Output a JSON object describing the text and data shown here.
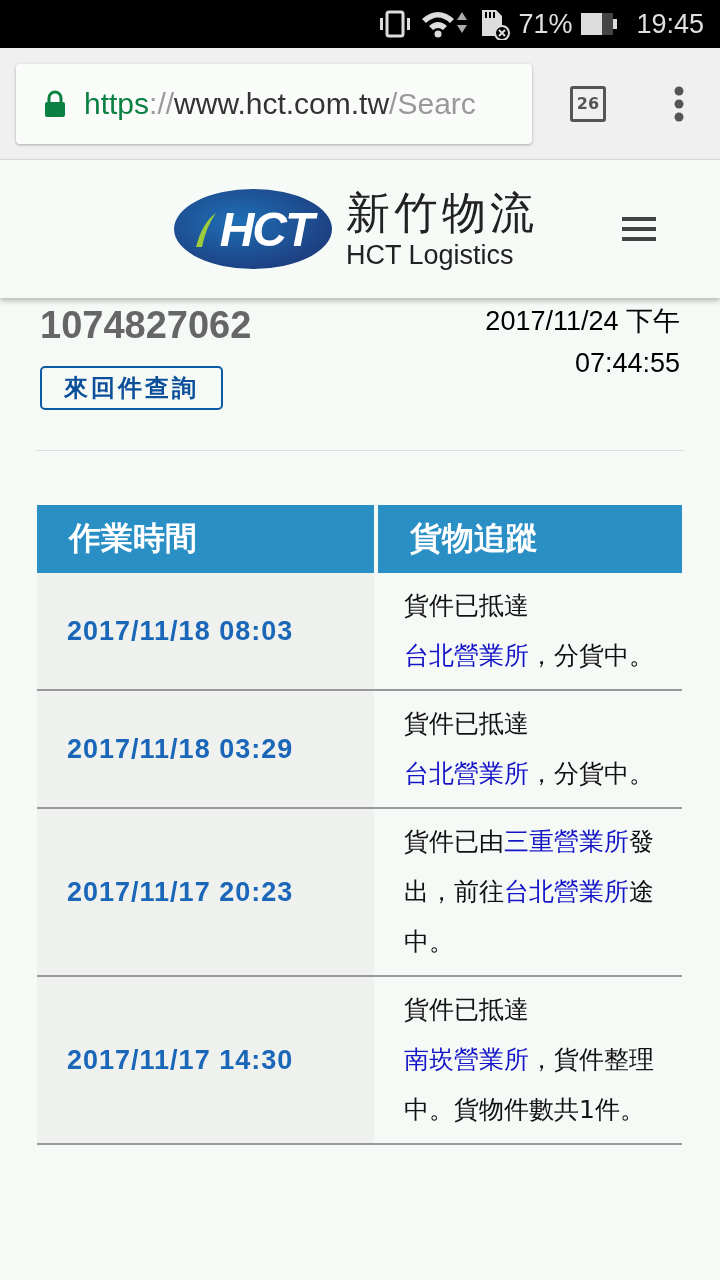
{
  "status_bar": {
    "battery_text": "71%",
    "time": "19:45"
  },
  "browser": {
    "url": [
      {
        "text": "https",
        "kind": "scheme"
      },
      {
        "text": "://",
        "kind": "dim"
      },
      {
        "text": "www.hct.com.tw",
        "kind": "host"
      },
      {
        "text": "/Searc",
        "kind": "dim"
      }
    ],
    "tab_count": "26"
  },
  "site_header": {
    "logo_mark": "HCT",
    "logo_title": "新竹物流",
    "logo_subtitle": "HCT Logistics"
  },
  "summary": {
    "tracking_number": "1074827062",
    "button": "來回件查詢",
    "datetime": "2017/11/24 下午 07:44:55"
  },
  "table": {
    "columns": [
      "作業時間",
      "貨物追蹤"
    ],
    "rows": [
      {
        "time": "2017/11/18 08:03",
        "status": [
          {
            "text": "貨件已抵達",
            "kind": "plain"
          },
          {
            "text": "台北營業所",
            "kind": "link"
          },
          {
            "text": "，分貨中。",
            "kind": "plain"
          }
        ]
      },
      {
        "time": "2017/11/18 03:29",
        "status": [
          {
            "text": "貨件已抵達",
            "kind": "plain"
          },
          {
            "text": "台北營業所",
            "kind": "link"
          },
          {
            "text": "，分貨中。",
            "kind": "plain"
          }
        ]
      },
      {
        "time": "2017/11/17 20:23",
        "status": [
          {
            "text": "貨件已由",
            "kind": "plain"
          },
          {
            "text": "三重營業所",
            "kind": "link"
          },
          {
            "text": "發出，前往",
            "kind": "plain"
          },
          {
            "text": "台北營業所",
            "kind": "link"
          },
          {
            "text": "途中。",
            "kind": "plain"
          }
        ]
      },
      {
        "time": "2017/11/17 14:30",
        "status": [
          {
            "text": "貨件已抵達",
            "kind": "plain"
          },
          {
            "text": "南崁營業所",
            "kind": "link"
          },
          {
            "text": "，貨件整理中。貨物件數共1件。",
            "kind": "plain"
          }
        ]
      }
    ]
  }
}
